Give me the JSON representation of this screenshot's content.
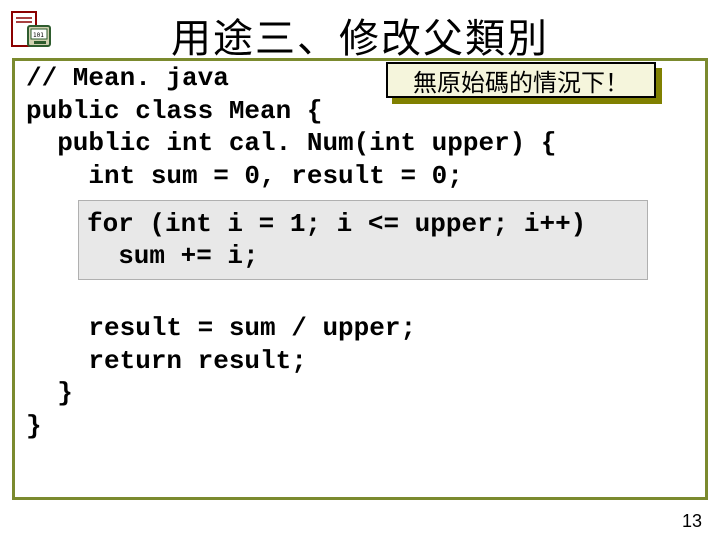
{
  "title": "用途三、修改父類別",
  "callout": "無原始碼的情況下！",
  "code": {
    "block1": "// Mean. java\npublic class Mean {\n  public int cal. Num(int upper) {\n    int sum = 0, result = 0;",
    "highlight": "for (int i = 1; i <= upper; i++)\n  sum += i;",
    "block2": "    result = sum / upper;\n    return result;\n  }\n}"
  },
  "page_number": "13",
  "icon_name": "program-icon"
}
